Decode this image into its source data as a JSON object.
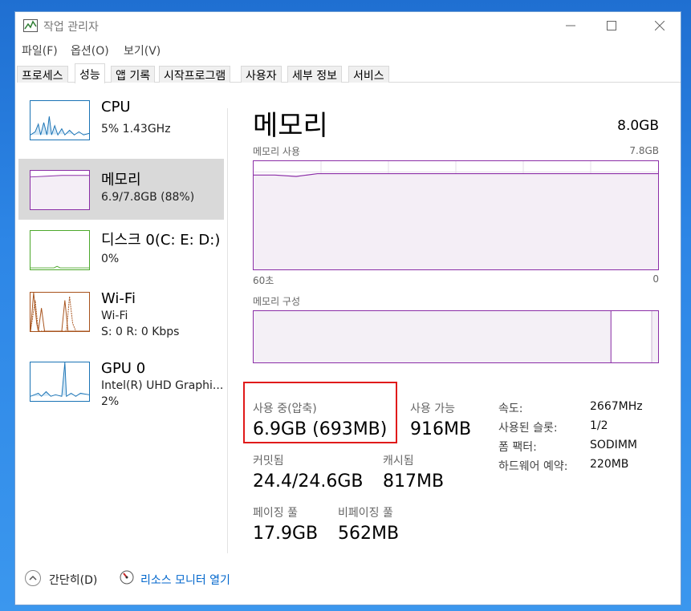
{
  "window": {
    "title": "작업 관리자"
  },
  "menu": [
    "파일(F)",
    "옵션(O)",
    "보기(V)"
  ],
  "tabs": [
    "프로세스",
    "성능",
    "앱 기록",
    "시작프로그램",
    "사용자",
    "세부 정보",
    "서비스"
  ],
  "sidebar": {
    "items": [
      {
        "title": "CPU",
        "sub1": "5%  1.43GHz",
        "sub2": ""
      },
      {
        "title": "메모리",
        "sub1": "6.9/7.8GB (88%)",
        "sub2": ""
      },
      {
        "title": "디스크 0(C: E: D:)",
        "sub1": "0%",
        "sub2": ""
      },
      {
        "title": "Wi-Fi",
        "sub1": "Wi-Fi",
        "sub2": "S: 0  R: 0 Kbps"
      },
      {
        "title": "GPU 0",
        "sub1": "Intel(R) UHD Graphi...",
        "sub2": "2%"
      }
    ]
  },
  "main": {
    "title": "메모리",
    "total": "8.0GB",
    "usage_label": "메모리 사용",
    "usage_max": "7.8GB",
    "time_left": "60초",
    "time_right": "0",
    "composition_label": "메모리 구성",
    "stats": {
      "in_use_label": "사용 중(압축)",
      "in_use_value": "6.9GB (693MB)",
      "available_label": "사용 가능",
      "available_value": "916MB",
      "committed_label": "커밋됨",
      "committed_value": "24.4/24.6GB",
      "cached_label": "캐시됨",
      "cached_value": "817MB",
      "paged_label": "페이징 풀",
      "paged_value": "17.9GB",
      "nonpaged_label": "비페이징 풀",
      "nonpaged_value": "562MB"
    },
    "details": [
      {
        "label": "속도:",
        "value": "2667MHz"
      },
      {
        "label": "사용된 슬롯:",
        "value": "1/2"
      },
      {
        "label": "폼 팩터:",
        "value": "SODIMM"
      },
      {
        "label": "하드웨어 예약:",
        "value": "220MB"
      }
    ]
  },
  "footer": {
    "collapse_label": "간단히(D)",
    "resmon_label": "리소스 모니터 열기"
  },
  "colors": {
    "memory": "#8b2ea7",
    "cpu": "#1a73b5",
    "disk": "#4ca82b",
    "wifi": "#a7521b",
    "highlight": "#e01a1a"
  },
  "chart_data": {
    "type": "line",
    "title": "메모리 사용",
    "xlabel": "",
    "ylabel": "",
    "x_range": [
      "60초",
      "0"
    ],
    "ylim": [
      0,
      7.8
    ],
    "series": [
      {
        "values": [
          6.8,
          6.8,
          6.7,
          6.9,
          6.9,
          6.9,
          6.9,
          6.9,
          6.9,
          6.9,
          6.9,
          6.9,
          6.9,
          6.9,
          6.9,
          6.9,
          6.9,
          6.9,
          6.9,
          6.9
        ]
      }
    ]
  }
}
